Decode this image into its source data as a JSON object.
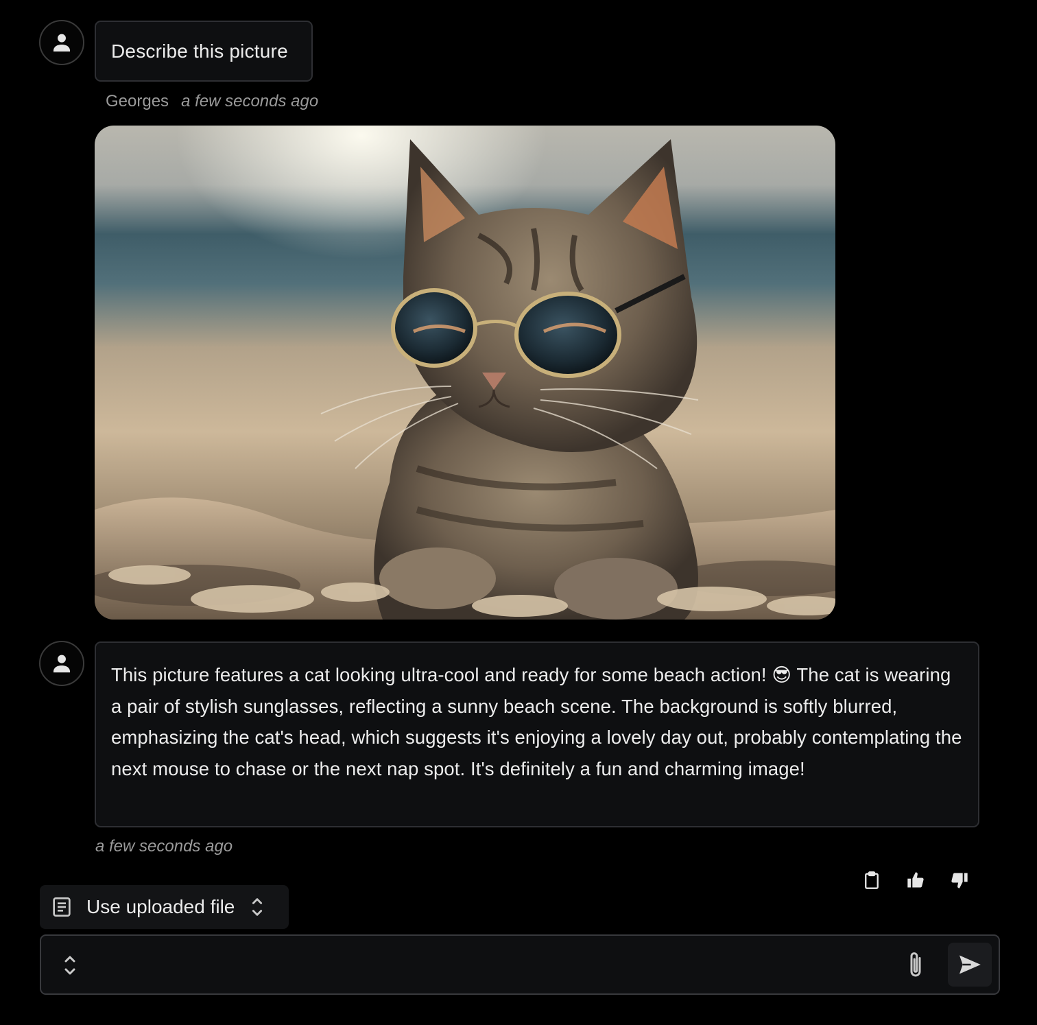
{
  "conversation": {
    "user_message": {
      "text": "Describe this picture",
      "author": "Georges",
      "timestamp": "a few seconds ago",
      "attachment": "cat wearing sunglasses on a sandy beach"
    },
    "assistant_message": {
      "text_before_emoji": "This picture features a cat looking ultra-cool and ready for some beach action! ",
      "emoji": "😎",
      "text_after_emoji": " The cat is wearing a pair of stylish sunglasses, reflecting a sunny beach scene. The background is softly blurred, emphasizing the cat's head, which suggests it's enjoying a lovely day out, probably contemplating the next mouse to chase or the next nap spot. It's definitely a fun and charming image!",
      "timestamp": "a few seconds ago"
    }
  },
  "actions": {
    "icons": [
      "clipboard-icon",
      "thumbs-up-icon",
      "thumbs-down-icon"
    ]
  },
  "composer": {
    "mode_label": "Use uploaded file",
    "input_value": "",
    "input_placeholder": ""
  },
  "colors": {
    "background": "#000000",
    "bubble": "#0e0f11",
    "border": "#2e2f33",
    "text": "#ececec",
    "muted": "#9a9a9a"
  }
}
